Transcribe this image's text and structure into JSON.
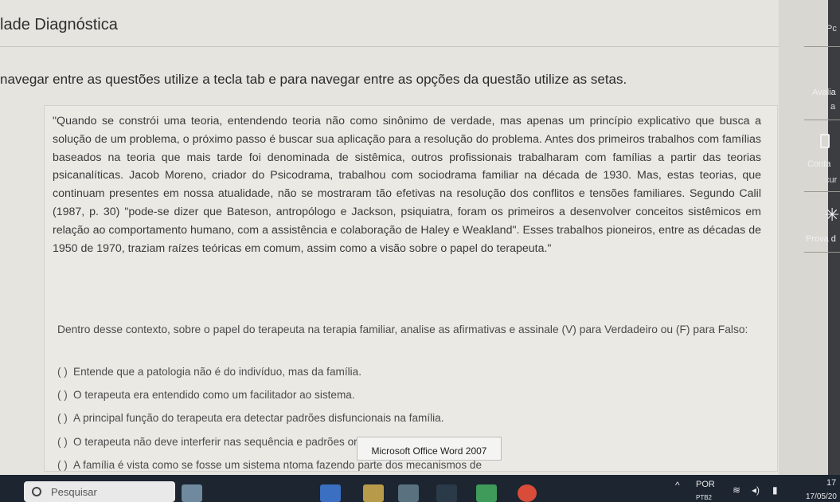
{
  "header": {
    "title": "lade Diagnóstica",
    "instructions": "navegar entre as questões utilize a tecla tab e para navegar entre as opções da questão utilize as setas."
  },
  "question": {
    "quote": "\"Quando se constrói uma teoria, entendendo teoria não como sinônimo de verdade, mas apenas um princípio explicativo que busca a solução de um problema, o próximo passo é buscar sua aplicação para a resolução do problema. Antes dos primeiros trabalhos com famílias baseados na teoria que mais tarde foi denominada de sistêmica, outros profissionais trabalharam com famílias a partir das teorias psicanalíticas. Jacob Moreno, criador do Psicodrama, trabalhou com sociodrama familiar na década de 1930. Mas, estas teorias, que continuam presentes em nossa atualidade, não se mostraram tão efetivas na resolução dos conflitos e tensões familiares. Segundo Calil (1987, p. 30) \"pode-se dizer que Bateson, antropólogo e Jackson, psiquiatra, foram os primeiros a desenvolver conceitos sistêmicos em relação ao comportamento humano, com a assistência e colaboração de Haley e Weakland\". Esses trabalhos pioneiros, entre as décadas de 1950 de 1970, traziam raízes teóricas em comum, assim como a visão sobre o papel do terapeuta.\"",
    "prompt": "Dentro desse contexto, sobre o papel do terapeuta na terapia familiar, analise as afirmativas e assinale (V) para Verdadeiro ou (F) para Falso:",
    "options": [
      {
        "marker": "(   )",
        "text": "Entende que a patologia não é do indivíduo, mas da família."
      },
      {
        "marker": "(   )",
        "text": "O terapeuta era entendido como um facilitador ao sistema."
      },
      {
        "marker": "(   )",
        "text": "A principal função do terapeuta era detectar padrões disfuncionais na família."
      },
      {
        "marker": "(   )",
        "text": "O terapeuta não deve interferir nas sequência                                                  e padrões organizacionais das famílias."
      },
      {
        "marker": "(   )",
        "text": "A família é vista como se fosse um sistema                                                  ntoma fazendo parte dos mecanismos de"
      }
    ]
  },
  "tooltip": {
    "text": "Microsoft Office Word 2007"
  },
  "right_panel": {
    "item_1": "Pc",
    "item_2": "Avalia",
    "item_3": "a",
    "item_4": "Conta",
    "item_5": "cur",
    "item_6": "Prova d"
  },
  "taskbar": {
    "search_placeholder": "Pesquisar",
    "language": "POR",
    "language_sub": "PTB2",
    "time": "17",
    "date": "17/05/20"
  }
}
